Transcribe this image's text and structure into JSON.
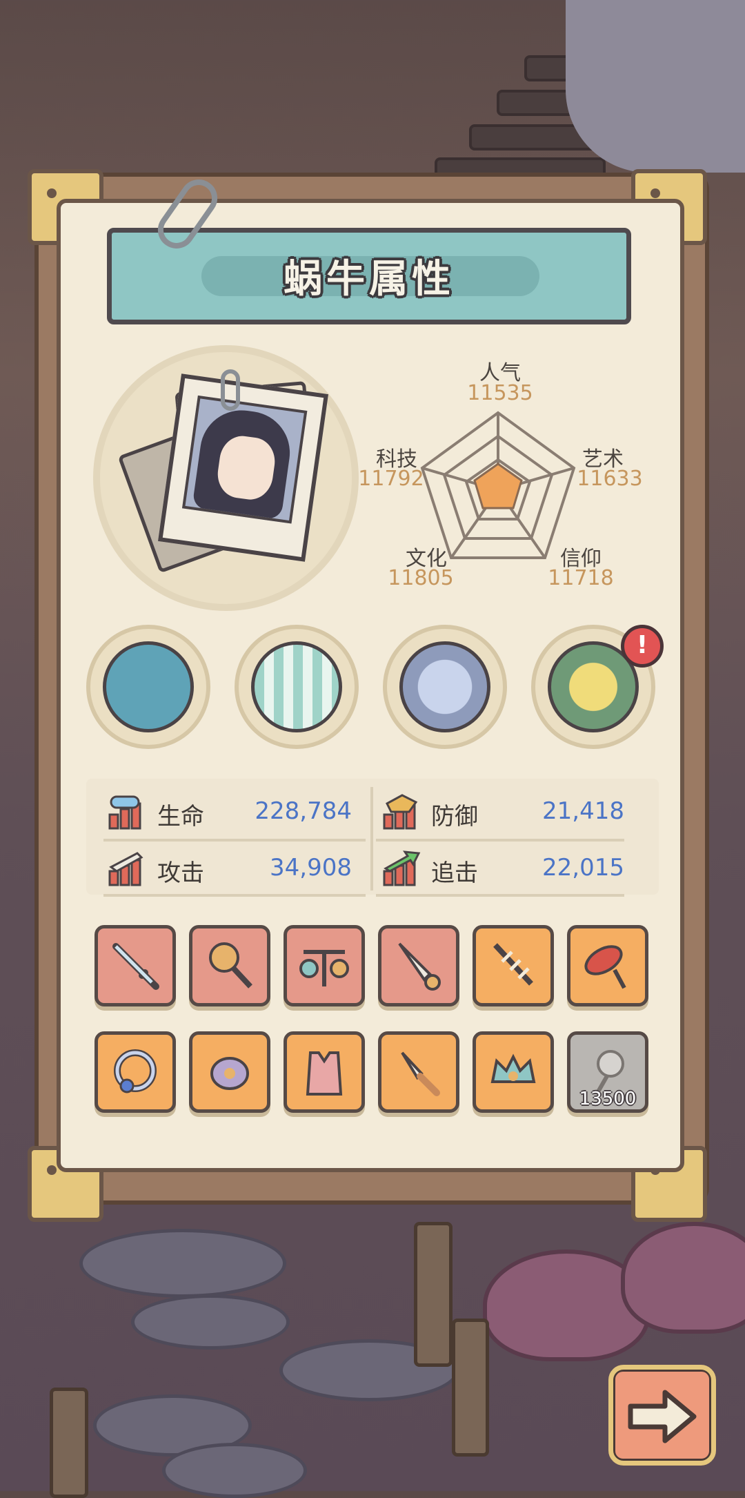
{
  "title": "蜗牛属性",
  "radar": {
    "stats": [
      {
        "name": "人气",
        "value": "11535"
      },
      {
        "name": "艺术",
        "value": "11633"
      },
      {
        "name": "信仰",
        "value": "11718"
      },
      {
        "name": "文化",
        "value": "11805"
      },
      {
        "name": "科技",
        "value": "11792"
      }
    ]
  },
  "attributes": [
    {
      "name": "生命",
      "value": "228,784",
      "icon": "heart-bars-icon"
    },
    {
      "name": "防御",
      "value": "21,418",
      "icon": "shield-bars-icon"
    },
    {
      "name": "攻击",
      "value": "34,908",
      "icon": "sword-bars-icon"
    },
    {
      "name": "追击",
      "value": "22,015",
      "icon": "arrow-bars-icon"
    }
  ],
  "equipment": [
    "monster-gear-icon",
    "plaid-shirt-icon",
    "compass-icon",
    "leaf-brazier-icon"
  ],
  "items": {
    "row1": [
      "sword-icon",
      "mask-scepter-icon",
      "scale-trinket-icon",
      "ornate-dagger-icon",
      "fishbone-sword-icon",
      "rocket-lamp-icon"
    ],
    "row2": [
      "gem-ring-icon",
      "beetle-icon",
      "vest-icon",
      "knife-icon",
      "crown-icon",
      "rose-icon"
    ],
    "locked_cost": "13500"
  },
  "colors": {
    "accent": "#8fc6c4",
    "value_blue": "#4b74c6",
    "radar_value": "#c6965d",
    "alert": "#e25454"
  }
}
